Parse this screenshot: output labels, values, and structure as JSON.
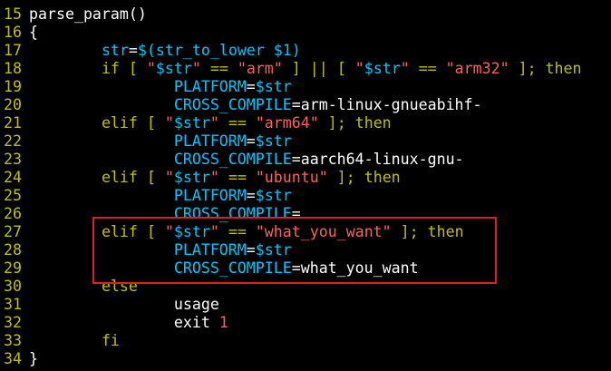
{
  "colors": {
    "background": "#000000",
    "line_number": "#c0c000",
    "keyword": "#c0c000",
    "variable": "#00c8ff",
    "string": "#ff6060",
    "plain": "#ffffff",
    "highlight_box": "#e02020"
  },
  "lines": [
    {
      "num": "15",
      "tokens": [
        {
          "t": "parse_param()",
          "c": "plain"
        }
      ]
    },
    {
      "num": "16",
      "tokens": [
        {
          "t": "{",
          "c": "plain"
        }
      ]
    },
    {
      "num": "17",
      "tokens": [
        {
          "t": "        ",
          "c": "plain"
        },
        {
          "t": "str",
          "c": "var"
        },
        {
          "t": "=",
          "c": "plain"
        },
        {
          "t": "$(",
          "c": "var"
        },
        {
          "t": "str_to_lower $1",
          "c": "var"
        },
        {
          "t": ")",
          "c": "var"
        }
      ]
    },
    {
      "num": "18",
      "tokens": [
        {
          "t": "        ",
          "c": "plain"
        },
        {
          "t": "if [ ",
          "c": "keyword"
        },
        {
          "t": "\"",
          "c": "string"
        },
        {
          "t": "$str",
          "c": "var"
        },
        {
          "t": "\"",
          "c": "string"
        },
        {
          "t": " == ",
          "c": "keyword"
        },
        {
          "t": "\"arm\"",
          "c": "string"
        },
        {
          "t": " ] || [ ",
          "c": "keyword"
        },
        {
          "t": "\"",
          "c": "string"
        },
        {
          "t": "$str",
          "c": "var"
        },
        {
          "t": "\"",
          "c": "string"
        },
        {
          "t": " == ",
          "c": "keyword"
        },
        {
          "t": "\"arm32\"",
          "c": "string"
        },
        {
          "t": " ]; then",
          "c": "keyword"
        }
      ]
    },
    {
      "num": "19",
      "tokens": [
        {
          "t": "                ",
          "c": "plain"
        },
        {
          "t": "PLATFORM",
          "c": "var"
        },
        {
          "t": "=",
          "c": "plain"
        },
        {
          "t": "$str",
          "c": "var"
        }
      ]
    },
    {
      "num": "20",
      "tokens": [
        {
          "t": "                ",
          "c": "plain"
        },
        {
          "t": "CROSS_COMPILE",
          "c": "var"
        },
        {
          "t": "=arm-linux-gnueabihf-",
          "c": "plain"
        }
      ]
    },
    {
      "num": "21",
      "tokens": [
        {
          "t": "        ",
          "c": "plain"
        },
        {
          "t": "elif [ ",
          "c": "keyword"
        },
        {
          "t": "\"",
          "c": "string"
        },
        {
          "t": "$str",
          "c": "var"
        },
        {
          "t": "\"",
          "c": "string"
        },
        {
          "t": " == ",
          "c": "keyword"
        },
        {
          "t": "\"arm64\"",
          "c": "string"
        },
        {
          "t": " ]; then",
          "c": "keyword"
        }
      ]
    },
    {
      "num": "22",
      "tokens": [
        {
          "t": "                ",
          "c": "plain"
        },
        {
          "t": "PLATFORM",
          "c": "var"
        },
        {
          "t": "=",
          "c": "plain"
        },
        {
          "t": "$str",
          "c": "var"
        }
      ]
    },
    {
      "num": "23",
      "tokens": [
        {
          "t": "                ",
          "c": "plain"
        },
        {
          "t": "CROSS_COMPILE",
          "c": "var"
        },
        {
          "t": "=aarch64-linux-gnu-",
          "c": "plain"
        }
      ]
    },
    {
      "num": "24",
      "tokens": [
        {
          "t": "        ",
          "c": "plain"
        },
        {
          "t": "elif [ ",
          "c": "keyword"
        },
        {
          "t": "\"",
          "c": "string"
        },
        {
          "t": "$str",
          "c": "var"
        },
        {
          "t": "\"",
          "c": "string"
        },
        {
          "t": " == ",
          "c": "keyword"
        },
        {
          "t": "\"ubuntu\"",
          "c": "string"
        },
        {
          "t": " ]; then",
          "c": "keyword"
        }
      ]
    },
    {
      "num": "25",
      "tokens": [
        {
          "t": "                ",
          "c": "plain"
        },
        {
          "t": "PLATFORM",
          "c": "var"
        },
        {
          "t": "=",
          "c": "plain"
        },
        {
          "t": "$str",
          "c": "var"
        }
      ]
    },
    {
      "num": "26",
      "tokens": [
        {
          "t": "                ",
          "c": "plain"
        },
        {
          "t": "CROSS_COMPILE",
          "c": "var"
        },
        {
          "t": "=",
          "c": "plain"
        }
      ]
    },
    {
      "num": "27",
      "tokens": [
        {
          "t": "        ",
          "c": "plain"
        },
        {
          "t": "elif [ ",
          "c": "keyword"
        },
        {
          "t": "\"",
          "c": "string"
        },
        {
          "t": "$str",
          "c": "var"
        },
        {
          "t": "\"",
          "c": "string"
        },
        {
          "t": " == ",
          "c": "keyword"
        },
        {
          "t": "\"what_you_want\"",
          "c": "string"
        },
        {
          "t": " ]; then",
          "c": "keyword"
        }
      ]
    },
    {
      "num": "28",
      "tokens": [
        {
          "t": "                ",
          "c": "plain"
        },
        {
          "t": "PLATFORM",
          "c": "var"
        },
        {
          "t": "=",
          "c": "plain"
        },
        {
          "t": "$str",
          "c": "var"
        }
      ]
    },
    {
      "num": "29",
      "tokens": [
        {
          "t": "                ",
          "c": "plain"
        },
        {
          "t": "CROSS_COMPILE",
          "c": "var"
        },
        {
          "t": "=what_you_want",
          "c": "plain"
        }
      ]
    },
    {
      "num": "30",
      "tokens": [
        {
          "t": "        ",
          "c": "plain"
        },
        {
          "t": "else",
          "c": "keyword"
        }
      ]
    },
    {
      "num": "31",
      "tokens": [
        {
          "t": "                ",
          "c": "plain"
        },
        {
          "t": "usage",
          "c": "plain"
        }
      ]
    },
    {
      "num": "32",
      "tokens": [
        {
          "t": "                ",
          "c": "plain"
        },
        {
          "t": "exit ",
          "c": "plain"
        },
        {
          "t": "1",
          "c": "string"
        }
      ]
    },
    {
      "num": "33",
      "tokens": [
        {
          "t": "        ",
          "c": "plain"
        },
        {
          "t": "fi",
          "c": "keyword"
        }
      ]
    },
    {
      "num": "34",
      "tokens": [
        {
          "t": "}",
          "c": "plain"
        }
      ]
    }
  ]
}
